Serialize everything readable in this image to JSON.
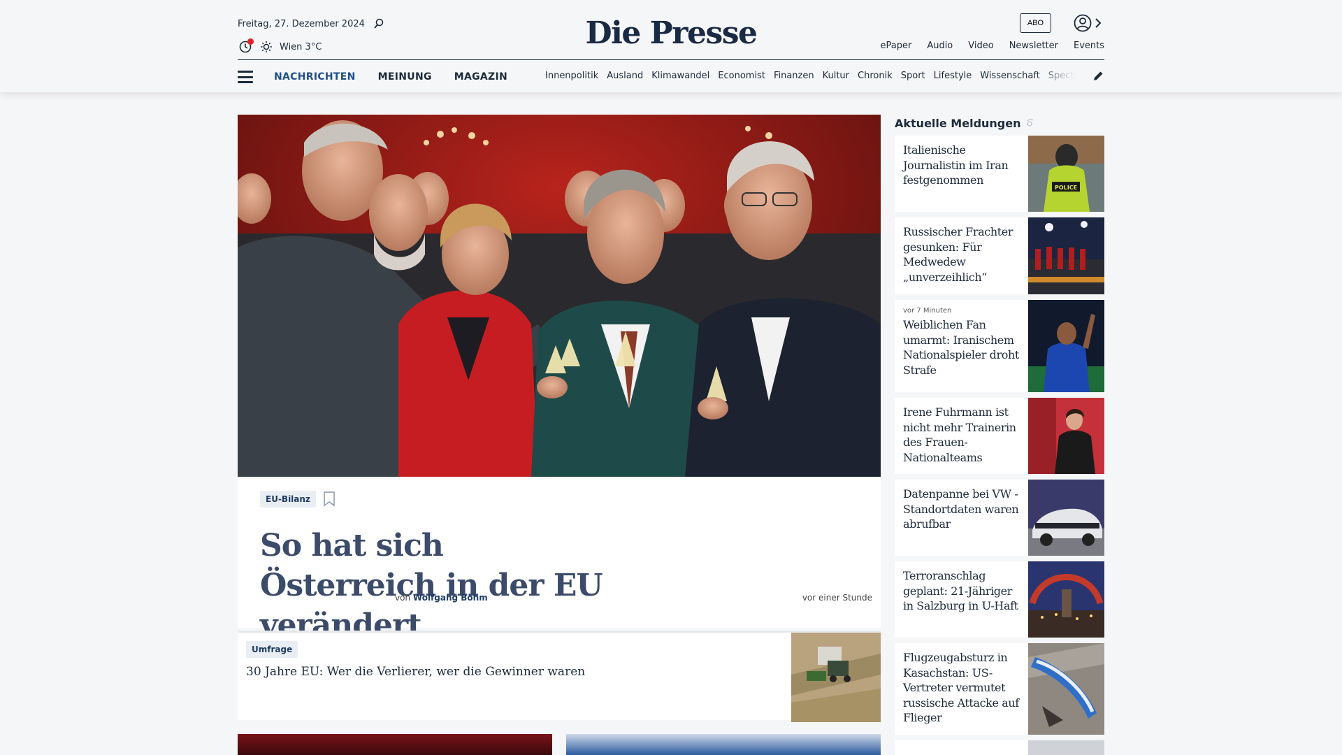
{
  "header": {
    "date": "Freitag, 27. Dezember 2024",
    "weather": "Wien 3°C",
    "logo": "Die Presse",
    "abo_label": "ABO",
    "utility_nav": [
      "ePaper",
      "Audio",
      "Video",
      "Newsletter",
      "Events"
    ],
    "main_nav": [
      "NACHRICHTEN",
      "MEINUNG",
      "MAGAZIN"
    ],
    "sections": [
      "Innenpolitik",
      "Ausland",
      "Klimawandel",
      "Economist",
      "Finanzen",
      "Kultur",
      "Chronik",
      "Sport",
      "Lifestyle",
      "Wissenschaft",
      "Spectrum"
    ]
  },
  "hero": {
    "tag": "EU-Bilanz",
    "title": "So hat sich Österreich in der EU verändert",
    "byline_prefix": "von",
    "author": "Wolfgang Böhm",
    "time": "vor einer Stunde"
  },
  "teaser": {
    "tag": "Umfrage",
    "title": "30 Jahre EU: Wer die Verlierer, wer die Gewinner waren"
  },
  "sidebar": {
    "heading": "Aktuelle Meldungen",
    "items": [
      {
        "time": "",
        "title": "Italienische Journalistin im Iran festgenommen"
      },
      {
        "time": "",
        "title": "Russischer Frachter gesunken: Für Medwedew „unverzeihlich“"
      },
      {
        "time": "vor 7 Minuten",
        "title": "Weiblichen Fan umarmt: Iranischem Nationalspieler droht Strafe"
      },
      {
        "time": "",
        "title": "Irene Fuhrmann ist nicht mehr Trainerin des Frauen-Nationalteams"
      },
      {
        "time": "",
        "title": "Datenpanne bei VW - Standortdaten waren abrufbar"
      },
      {
        "time": "",
        "title": "Terroranschlag geplant: 21-Jähriger in Salzburg in U-Haft"
      },
      {
        "time": "",
        "title": "Flugzeugabsturz in Kasachstan: US-Vertreter vermutet russische Attacke auf Flieger"
      }
    ],
    "thumb_texts": {
      "police": "POLICE"
    }
  },
  "colors": {
    "background": "#f5f6f7",
    "navy": "#1c2a3a",
    "accent_blue": "#1f4f8a",
    "headline": "#3b4b69",
    "tag_bg": "#e9eef4",
    "notification_red": "#e0242a"
  }
}
